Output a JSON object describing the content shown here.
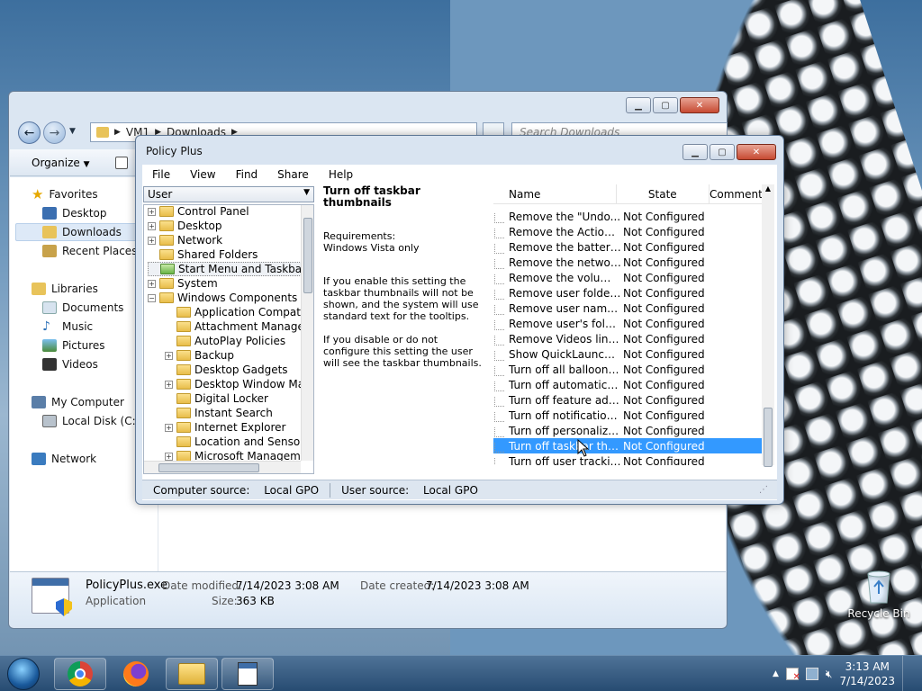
{
  "explorer": {
    "address": [
      "VM1",
      "Downloads"
    ],
    "search_placeholder": "Search Downloads",
    "toolbar": {
      "organize": "Organize"
    },
    "sidebar": {
      "favorites": "Favorites",
      "desktop": "Desktop",
      "downloads": "Downloads",
      "recent": "Recent Places",
      "libraries": "Libraries",
      "documents": "Documents",
      "music": "Music",
      "pictures": "Pictures",
      "videos": "Videos",
      "computer": "My Computer",
      "local_disk": "Local Disk (C:)",
      "network": "Network"
    },
    "details": {
      "filename": "PolicyPlus.exe",
      "type": "Application",
      "modified_label": "Date modified:",
      "modified": "7/14/2023 3:08 AM",
      "created_label": "Date created:",
      "created": "7/14/2023 3:08 AM",
      "size_label": "Size:",
      "size": "363 KB"
    }
  },
  "policy_plus": {
    "title": "Policy Plus",
    "menu": [
      "File",
      "View",
      "Find",
      "Share",
      "Help"
    ],
    "scope": "User",
    "tree": [
      {
        "label": "Control Panel",
        "level": 1,
        "exp": true
      },
      {
        "label": "Desktop",
        "level": 1,
        "exp": true
      },
      {
        "label": "Network",
        "level": 1,
        "exp": true
      },
      {
        "label": "Shared Folders",
        "level": 1,
        "exp": false
      },
      {
        "label": "Start Menu and Taskbar",
        "level": 1,
        "exp": false,
        "selected": true
      },
      {
        "label": "System",
        "level": 1,
        "exp": true
      },
      {
        "label": "Windows Components",
        "level": 1,
        "exp": true,
        "open": true
      },
      {
        "label": "Application Compatibility",
        "level": 2,
        "exp": false
      },
      {
        "label": "Attachment Manager",
        "level": 2,
        "exp": false
      },
      {
        "label": "AutoPlay Policies",
        "level": 2,
        "exp": false
      },
      {
        "label": "Backup",
        "level": 2,
        "exp": true
      },
      {
        "label": "Desktop Gadgets",
        "level": 2,
        "exp": false
      },
      {
        "label": "Desktop Window Mana",
        "level": 2,
        "exp": true
      },
      {
        "label": "Digital Locker",
        "level": 2,
        "exp": false
      },
      {
        "label": "Instant Search",
        "level": 2,
        "exp": false
      },
      {
        "label": "Internet Explorer",
        "level": 2,
        "exp": true
      },
      {
        "label": "Location and Sensors",
        "level": 2,
        "exp": false
      },
      {
        "label": "Microsoft Management",
        "level": 2,
        "exp": true
      }
    ],
    "description": {
      "title": "Turn off taskbar thumbnails",
      "requirements_label": "Requirements:",
      "requirements": "Windows Vista only",
      "para1": "If you enable this setting the taskbar thumbnails will not be shown, and the system will use standard text for the tooltips.",
      "para2": "If you disable or do not configure this setting the user will see the taskbar thumbnails."
    },
    "columns": [
      "Name",
      "State",
      "Comment"
    ],
    "rows": [
      {
        "name": "Remove the \"Undo...",
        "state": "Not Configured"
      },
      {
        "name": "Remove the Action ...",
        "state": "Not Configured"
      },
      {
        "name": "Remove the battery ...",
        "state": "Not Configured"
      },
      {
        "name": "Remove the networ...",
        "state": "Not Configured"
      },
      {
        "name": "Remove the volume...",
        "state": "Not Configured"
      },
      {
        "name": "Remove user folder l...",
        "state": "Not Configured"
      },
      {
        "name": "Remove user name ...",
        "state": "Not Configured"
      },
      {
        "name": "Remove user's folde...",
        "state": "Not Configured"
      },
      {
        "name": "Remove Videos link ...",
        "state": "Not Configured"
      },
      {
        "name": "Show QuickLaunch ...",
        "state": "Not Configured"
      },
      {
        "name": "Turn off all balloon n...",
        "state": "Not Configured"
      },
      {
        "name": "Turn off automatic p...",
        "state": "Not Configured"
      },
      {
        "name": "Turn off feature adv...",
        "state": "Not Configured"
      },
      {
        "name": "Turn off notification ...",
        "state": "Not Configured"
      },
      {
        "name": "Turn off personalize...",
        "state": "Not Configured"
      },
      {
        "name": "Turn off taskbar thu...",
        "state": "Not Configured",
        "selected": true
      },
      {
        "name": "Turn off user tracking",
        "state": "Not Configured"
      }
    ],
    "status": {
      "computer_label": "Computer source:",
      "computer": "Local GPO",
      "user_label": "User source:",
      "user": "Local GPO"
    }
  },
  "desktop": {
    "recycle_bin": "Recycle Bin"
  },
  "taskbar": {
    "time": "3:13 AM",
    "date": "7/14/2023"
  }
}
